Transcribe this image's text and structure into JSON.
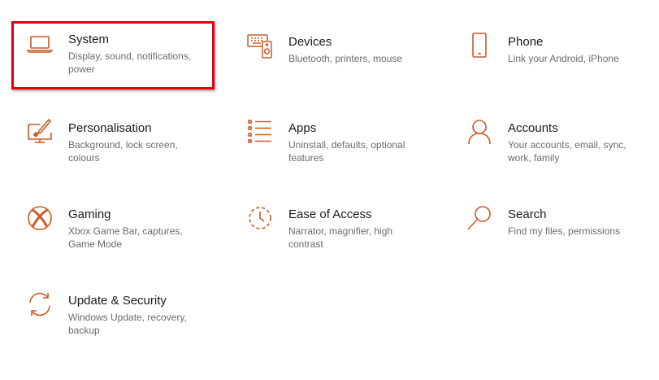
{
  "accent_color": "#cc5a26",
  "selection_color": "#e0000f",
  "tiles": [
    {
      "title": "System",
      "desc": "Display, sound, notifications, power",
      "icon": "laptop-icon"
    },
    {
      "title": "Devices",
      "desc": "Bluetooth, printers, mouse",
      "icon": "devices-icon"
    },
    {
      "title": "Phone",
      "desc": "Link your Android, iPhone",
      "icon": "phone-icon"
    },
    {
      "title": "Personalisation",
      "desc": "Background, lock screen, colours",
      "icon": "personalisation-icon"
    },
    {
      "title": "Apps",
      "desc": "Uninstall, defaults, optional features",
      "icon": "apps-list-icon"
    },
    {
      "title": "Accounts",
      "desc": "Your accounts, email, sync, work, family",
      "icon": "person-icon"
    },
    {
      "title": "Gaming",
      "desc": "Xbox Game Bar, captures, Game Mode",
      "icon": "xbox-icon"
    },
    {
      "title": "Ease of Access",
      "desc": "Narrator, magnifier, high contrast",
      "icon": "ease-of-access-icon"
    },
    {
      "title": "Search",
      "desc": "Find my files, permissions",
      "icon": "magnifier-icon"
    },
    {
      "title": "Update & Security",
      "desc": "Windows Update, recovery, backup",
      "icon": "update-icon"
    }
  ]
}
